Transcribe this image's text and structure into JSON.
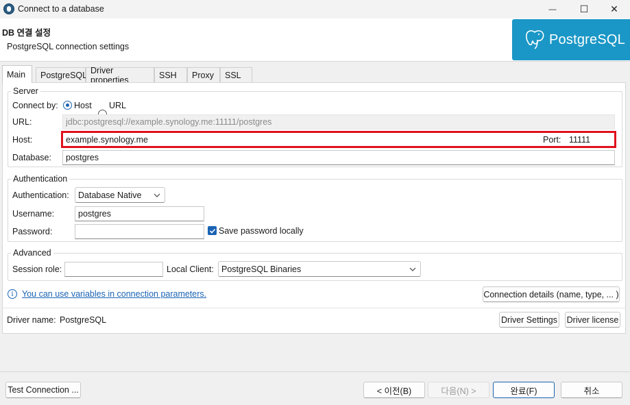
{
  "window": {
    "title": "Connect to a database",
    "minimize": "—",
    "maximize": "☐",
    "close": "✕"
  },
  "header": {
    "title": "DB 연결 설정",
    "subtitle": "PostgreSQL connection settings",
    "logo_text": "PostgreSQL"
  },
  "tabs": [
    "Main",
    "PostgreSQL",
    "Driver properties",
    "SSH",
    "Proxy",
    "SSL"
  ],
  "server": {
    "group_title": "Server",
    "connect_by_label": "Connect by:",
    "option_host": "Host",
    "option_url": "URL",
    "url_label": "URL:",
    "url_value": "jdbc:postgresql://example.synology.me:11111/postgres",
    "host_label": "Host:",
    "host_value": "example.synology.me",
    "port_label": "Port:",
    "port_value": "11111",
    "database_label": "Database:",
    "database_value": "postgres"
  },
  "authentication": {
    "group_title": "Authentication",
    "auth_label": "Authentication:",
    "auth_value": "Database Native",
    "username_label": "Username:",
    "username_value": "postgres",
    "password_label": "Password:",
    "password_value": "",
    "save_password_label": "Save password locally"
  },
  "advanced": {
    "group_title": "Advanced",
    "session_role_label": "Session role:",
    "session_role_value": "",
    "local_client_label": "Local Client:",
    "local_client_value": "PostgreSQL Binaries"
  },
  "info_link": "You can use variables in connection parameters.",
  "connection_details_button": "Connection details (name, type, ... )",
  "driver": {
    "name_label": "Driver name:",
    "name_value": "PostgreSQL",
    "settings_button": "Driver Settings",
    "license_button": "Driver license"
  },
  "footer": {
    "test_connection": "Test Connection ...",
    "back": "< 이전(B)",
    "next": "다음(N) >",
    "finish": "완료(F)",
    "cancel": "취소"
  },
  "colors": {
    "accent": "#1a63b4",
    "highlight": "#e0101e",
    "logo_bg": "#1a97c6",
    "link": "#1a63b4"
  }
}
